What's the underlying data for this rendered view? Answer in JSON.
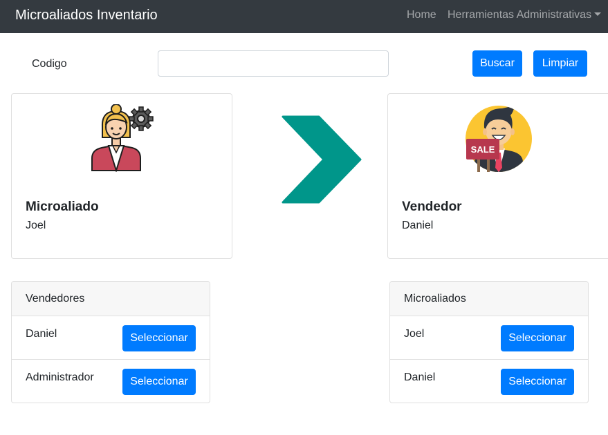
{
  "navbar": {
    "brand": "Microaliados Inventario",
    "links": [
      {
        "label": "Home"
      },
      {
        "label": "Herramientas Administrativas"
      }
    ]
  },
  "search": {
    "label": "Codigo",
    "value": "",
    "search_button": "Buscar",
    "clear_button": "Limpiar"
  },
  "cards": {
    "left": {
      "title": "Microaliado",
      "name": "Joel",
      "icon": "businesswoman-gear-icon"
    },
    "right": {
      "title": "Vendedor",
      "name": "Daniel",
      "icon": "salesman-sale-sign-icon"
    }
  },
  "arrow_icon": "chevron-right-icon",
  "panels": {
    "left": {
      "header": "Vendedores",
      "rows": [
        {
          "name": "Daniel",
          "button": "Seleccionar"
        },
        {
          "name": "Administrador",
          "button": "Seleccionar"
        }
      ]
    },
    "right": {
      "header": "Microaliados",
      "rows": [
        {
          "name": "Joel",
          "button": "Seleccionar"
        },
        {
          "name": "Daniel",
          "button": "Seleccionar"
        }
      ]
    }
  },
  "sale_sign_text": "SALE",
  "colors": {
    "navbar": "#343a40",
    "primary": "#007bff",
    "arrow": "#00968a"
  }
}
